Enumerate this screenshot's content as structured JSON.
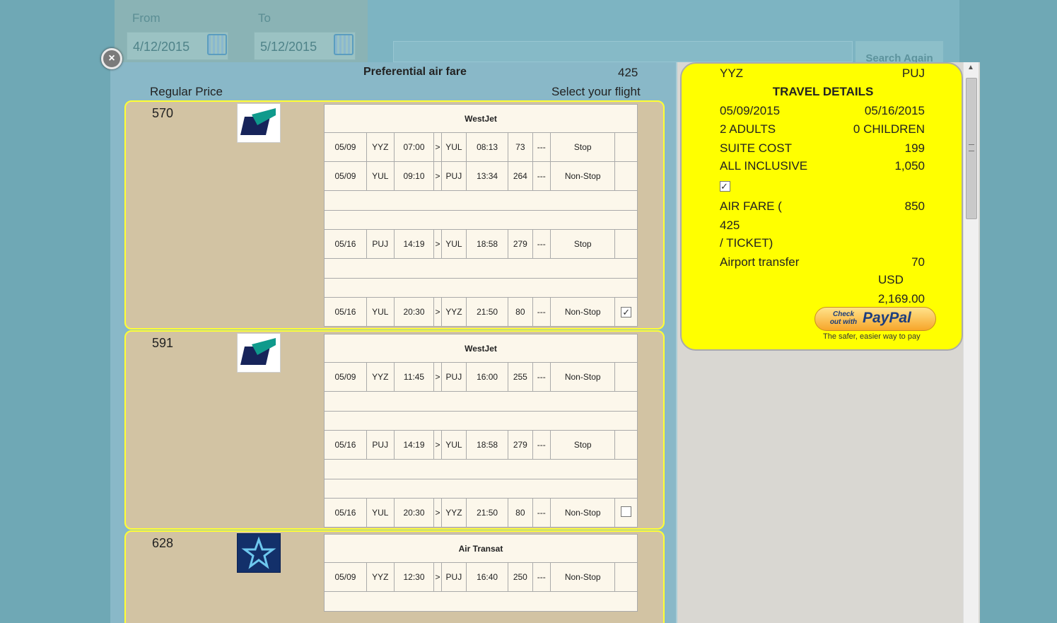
{
  "search": {
    "from_label": "From",
    "to_label": "To",
    "from_value": "4/12/2015",
    "to_value": "5/12/2015",
    "search_again": "Search Again"
  },
  "header": {
    "preferential_label": "Preferential air fare",
    "preferential_value": "425",
    "regular_price_label": "Regular Price",
    "select_flight_label": "Select your flight"
  },
  "flights": [
    {
      "price": "570",
      "airline": "WestJet",
      "segments": [
        {
          "date": "05/09",
          "from": "YYZ",
          "dep": "07:00",
          "arrow": ">",
          "to": "YUL",
          "arr": "08:13",
          "flight": "73",
          "dash": "---",
          "stop": "Stop"
        },
        {
          "date": "05/09",
          "from": "YUL",
          "dep": "09:10",
          "arrow": ">",
          "to": "PUJ",
          "arr": "13:34",
          "flight": "264",
          "dash": "---",
          "stop": "Non-Stop"
        },
        {
          "date": "05/16",
          "from": "PUJ",
          "dep": "14:19",
          "arrow": ">",
          "to": "YUL",
          "arr": "18:58",
          "flight": "279",
          "dash": "---",
          "stop": "Stop"
        },
        {
          "date": "05/16",
          "from": "YUL",
          "dep": "20:30",
          "arrow": ">",
          "to": "YYZ",
          "arr": "21:50",
          "flight": "80",
          "dash": "---",
          "stop": "Non-Stop"
        }
      ],
      "checked": "✓"
    },
    {
      "price": "591",
      "airline": "WestJet",
      "segments": [
        {
          "date": "05/09",
          "from": "YYZ",
          "dep": "11:45",
          "arrow": ">",
          "to": "PUJ",
          "arr": "16:00",
          "flight": "255",
          "dash": "---",
          "stop": "Non-Stop"
        },
        {
          "date": "05/16",
          "from": "PUJ",
          "dep": "14:19",
          "arrow": ">",
          "to": "YUL",
          "arr": "18:58",
          "flight": "279",
          "dash": "---",
          "stop": "Stop"
        },
        {
          "date": "05/16",
          "from": "YUL",
          "dep": "20:30",
          "arrow": ">",
          "to": "YYZ",
          "arr": "21:50",
          "flight": "80",
          "dash": "---",
          "stop": "Non-Stop"
        }
      ],
      "checked": ""
    },
    {
      "price": "628",
      "airline": "Air Transat",
      "segments": [
        {
          "date": "05/09",
          "from": "YYZ",
          "dep": "12:30",
          "arrow": ">",
          "to": "PUJ",
          "arr": "16:40",
          "flight": "250",
          "dash": "---",
          "stop": "Non-Stop"
        }
      ]
    }
  ],
  "details": {
    "origin": "YYZ",
    "destination": "PUJ",
    "title": "TRAVEL DETAILS",
    "depart_date": "05/09/2015",
    "return_date": "05/16/2015",
    "adults": "2 ADULTS",
    "children": "0 CHILDREN",
    "suite_label": "SUITE COST",
    "suite_value": "199",
    "inclusive_label": "ALL INCLUSIVE",
    "inclusive_value": "1,050",
    "inclusive_check": "✓",
    "airfare_label_1": "AIR FARE (",
    "airfare_label_2": "425",
    "airfare_label_3": "/ TICKET)",
    "airfare_value": "850",
    "transfer_label": "Airport transfer",
    "transfer_value": "70",
    "currency": "USD",
    "total": "2,169.00",
    "paypal_small": "Check out with",
    "paypal_brand": "PayPal",
    "paypal_tagline": "The safer, easier way to pay"
  },
  "colors": {
    "accent_yellow": "#ffff00",
    "flight_bg": "#d2c3a3",
    "modal_blue": "#89b8c8"
  }
}
